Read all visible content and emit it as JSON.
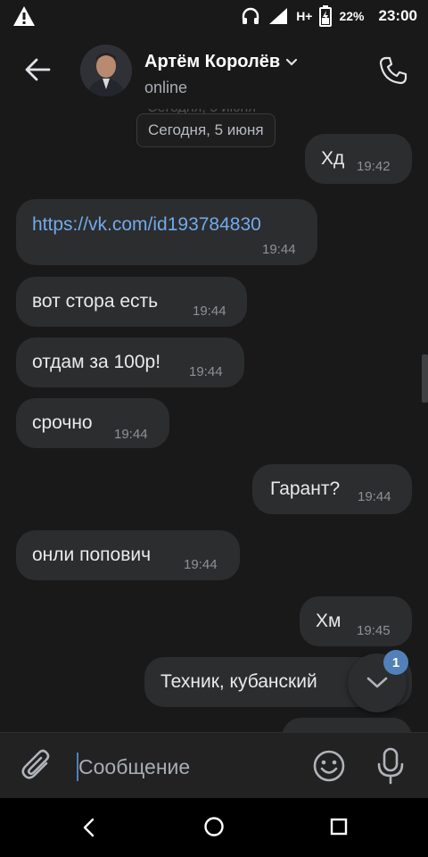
{
  "status_bar": {
    "battery_percent": "22%",
    "time": "23:00",
    "network": "H+",
    "icons": [
      "warning-icon",
      "headphones-icon",
      "signal-icon",
      "network-icon",
      "battery-icon"
    ]
  },
  "header": {
    "contact_name": "Артём Королёв",
    "status": "online",
    "icons": [
      "back-arrow-icon",
      "chevron-down-icon",
      "phone-icon"
    ]
  },
  "chat": {
    "date_label": "Сегодня, 5 июня",
    "date_ghost": "Сегодня, 5 июня",
    "messages": [
      {
        "side": "out",
        "text": "Хд",
        "time": "19:42"
      },
      {
        "side": "in",
        "text": "https://vk.com/id193784830",
        "time": "19:44",
        "is_link": true
      },
      {
        "side": "in",
        "text": "вот стора есть",
        "time": "19:44"
      },
      {
        "side": "in",
        "text": "отдам за 100р!",
        "time": "19:44"
      },
      {
        "side": "in",
        "text": "срочно",
        "time": "19:44"
      },
      {
        "side": "out",
        "text": "Гарант?",
        "time": "19:44"
      },
      {
        "side": "in",
        "text": "онли попович",
        "time": "19:44"
      },
      {
        "side": "out",
        "text": "Хм",
        "time": "19:45"
      },
      {
        "side": "out",
        "text": "Техник, кубанский",
        "time": ""
      }
    ],
    "unread_badge": "1"
  },
  "composer": {
    "placeholder": "Сообщение",
    "value": "",
    "icons": [
      "paperclip-icon",
      "emoji-icon",
      "microphone-icon"
    ]
  },
  "colors": {
    "background": "#19191a",
    "bubble": "#2c2d2f",
    "link": "#71aaeb",
    "accent": "#5181b8"
  }
}
